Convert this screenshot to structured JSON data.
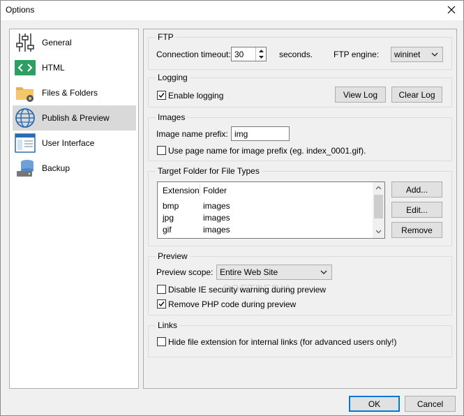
{
  "window": {
    "title": "Options"
  },
  "sidebar": {
    "items": [
      {
        "label": "General",
        "icon": "sliders-icon"
      },
      {
        "label": "HTML",
        "icon": "code-icon"
      },
      {
        "label": "Files & Folders",
        "icon": "folder-gear-icon"
      },
      {
        "label": "Publish & Preview",
        "icon": "globe-icon",
        "selected": true
      },
      {
        "label": "User Interface",
        "icon": "window-icon"
      },
      {
        "label": "Backup",
        "icon": "database-icon"
      }
    ]
  },
  "ftp": {
    "title": "FTP",
    "timeout_label": "Connection timeout:",
    "timeout_value": "30",
    "seconds_label": "seconds.",
    "engine_label": "FTP engine:",
    "engine_value": "wininet"
  },
  "logging": {
    "title": "Logging",
    "enable_label": "Enable logging",
    "enable_checked": true,
    "view_log": "View Log",
    "clear_log": "Clear Log"
  },
  "images": {
    "title": "Images",
    "prefix_label": "Image name prefix:",
    "prefix_value": "img",
    "use_page_name_label": "Use page name for image prefix (eg. index_0001.gif).",
    "use_page_name_checked": false
  },
  "target": {
    "title": "Target Folder for File Types",
    "columns": [
      "Extension",
      "Folder"
    ],
    "rows": [
      [
        "bmp",
        "images"
      ],
      [
        "jpg",
        "images"
      ],
      [
        "gif",
        "images"
      ]
    ],
    "add": "Add...",
    "edit": "Edit...",
    "remove": "Remove"
  },
  "preview": {
    "title": "Preview",
    "scope_label": "Preview scope:",
    "scope_value": "Entire Web Site",
    "disable_ie_label": "Disable IE security warning during preview",
    "disable_ie_checked": false,
    "remove_php_label": "Remove PHP code during preview",
    "remove_php_checked": true
  },
  "links": {
    "title": "Links",
    "hide_ext_label": "Hide file extension for internal links (for advanced users only!)",
    "hide_ext_checked": false
  },
  "footer": {
    "ok": "OK",
    "cancel": "Cancel"
  },
  "watermark": "SOFTPEDIA",
  "colors": {
    "selected_bg": "#d9d9d9",
    "accent": "#0078d7",
    "icon_blue": "#2b6cb0",
    "html_green": "#2e9e62"
  }
}
